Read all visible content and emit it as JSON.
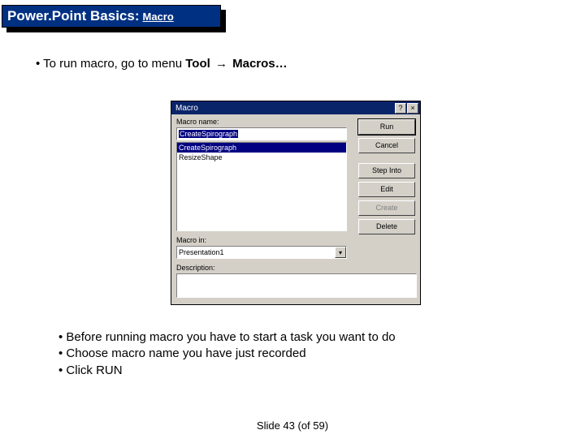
{
  "title": {
    "main": "Power.Point Basics:",
    "sub": "Macro"
  },
  "bullet_top": {
    "prefix": "• To run macro, go to menu ",
    "bold1": "Tool",
    "arrow": "→",
    "bold2": "Macros…"
  },
  "dialog": {
    "title": "Macro",
    "help": "?",
    "close": "×",
    "label_name": "Macro name:",
    "name_value": "CreateSpirograph",
    "list": [
      "CreateSpirograph",
      "ResizeShape"
    ],
    "label_in": "Macro in:",
    "combo_value": "Presentation1",
    "combo_chevron": "▾",
    "label_desc": "Description:",
    "buttons": {
      "run": "Run",
      "cancel": "Cancel",
      "step": "Step Into",
      "edit": "Edit",
      "create": "Create",
      "delete": "Delete"
    }
  },
  "bullets_bottom": {
    "a": "• Before running macro you have to start a task you want to do",
    "b": "• Choose macro name you have just recorded",
    "c": "• Click RUN"
  },
  "footer": "Slide  43 (of  59)"
}
